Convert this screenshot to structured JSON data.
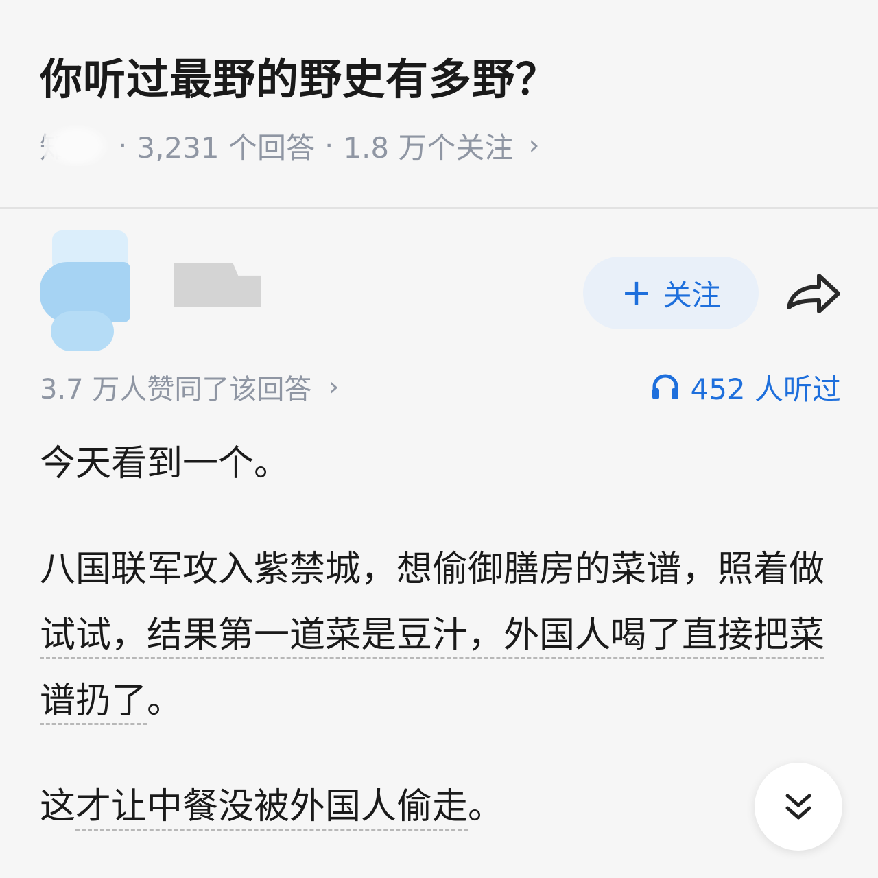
{
  "question": {
    "title": "你听过最野的野史有多野？",
    "source": "知乎",
    "answers_count": "3,231 个回答",
    "followers_count": "1.8 万个关注",
    "separator": "·",
    "more_glyph": "›"
  },
  "answer_header": {
    "follow_button": {
      "plus": "+",
      "label": "关注"
    },
    "share_icon": "share-arrow-icon",
    "upvotes_text": "3.7 万人赞同了该回答",
    "upvotes_more_glyph": "›",
    "listen_icon": "headphones-icon",
    "listen_text": "452 人听过"
  },
  "content": {
    "p1": "今天看到一个。",
    "p2_a": "八国联军攻入紫禁城，想偷御膳房的菜谱，照着做",
    "p2_link1": "试试，结果第一道菜是豆汁，外国人喝了直接",
    "p2_link2": "把菜谱扔了",
    "p2_end": "。",
    "p3_a": "这",
    "p3_link": "才让中餐没被外国人偷走",
    "p3_end": "。"
  },
  "colors": {
    "accent": "#1e6fdc",
    "meta_gray": "#8f96a3",
    "background": "#f6f6f6",
    "follow_button_bg": "#e9f0f9"
  },
  "expand_icon": "double-chevron-down-icon"
}
